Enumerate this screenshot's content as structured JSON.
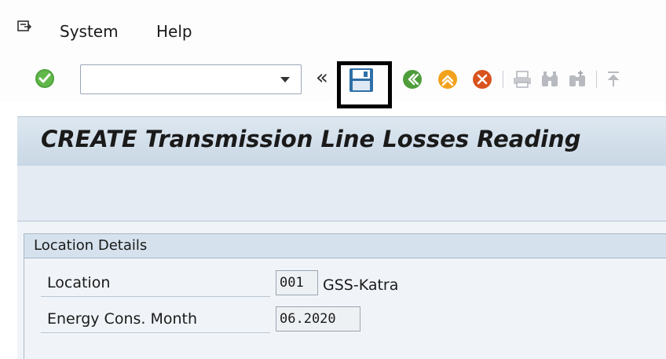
{
  "menu": {
    "system_label": "System",
    "help_label": "Help"
  },
  "toolbar": {
    "command_field_value": "",
    "icons": [
      "enter-icon",
      "expand-icon",
      "save-icon",
      "back-icon",
      "exit-icon",
      "cancel-icon",
      "print-icon",
      "find-icon",
      "find-next-icon",
      "first-page-icon"
    ]
  },
  "page": {
    "title": "CREATE Transmission Line Losses Reading"
  },
  "location_details": {
    "group_title": "Location Details",
    "location_label": "Location",
    "location_code": "001",
    "location_name": "GSS-Katra",
    "energy_month_label": "Energy Cons. Month",
    "energy_month_value": "06.2020"
  },
  "colors": {
    "title_bar": "#c9d8e5",
    "group_header": "#d5e1ec",
    "highlight_border": "#000000"
  }
}
